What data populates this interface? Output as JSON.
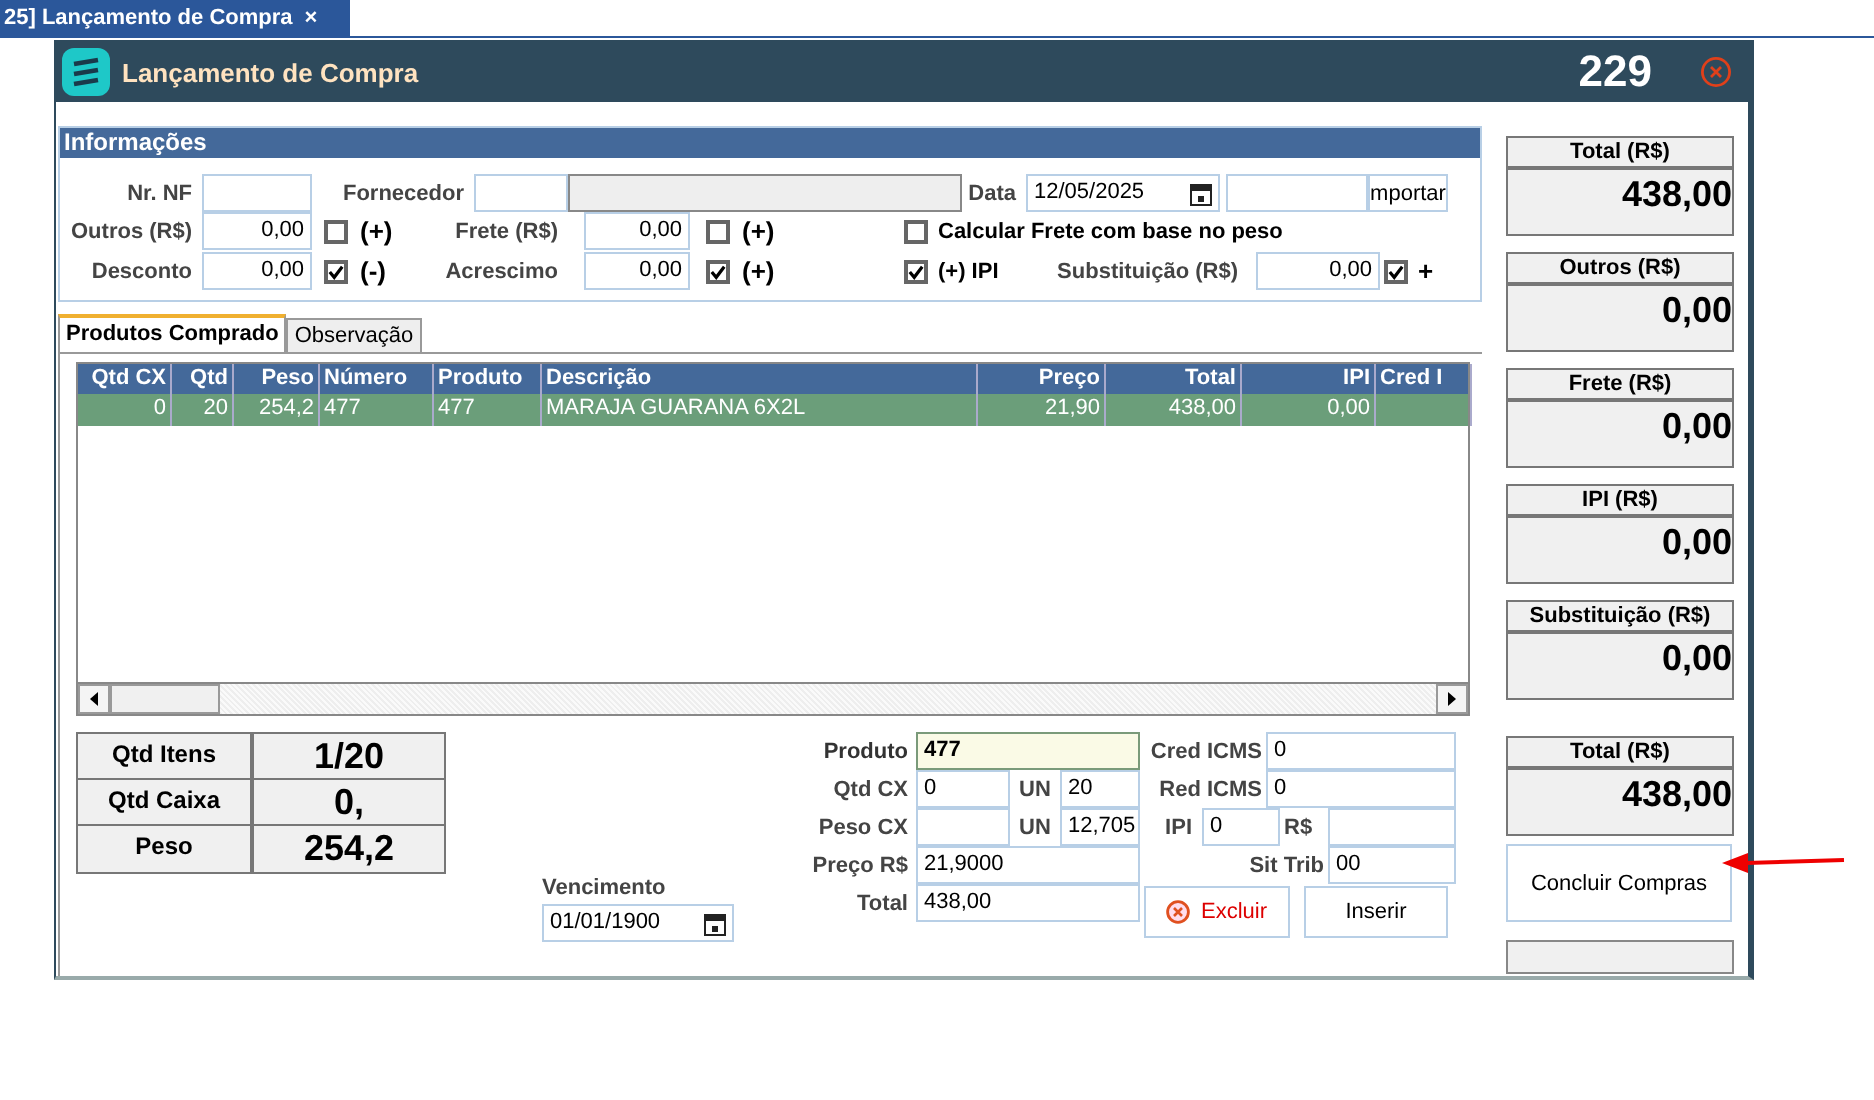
{
  "app_tab": {
    "label": "25] Lançamento de Compra",
    "close": "×"
  },
  "window": {
    "title": "Lançamento de Compra",
    "number": "229"
  },
  "info": {
    "title": "Informações",
    "nr_nf": {
      "label": "Nr. NF"
    },
    "fornecedor": {
      "label": "Fornecedor"
    },
    "data": {
      "label": "Data",
      "value": "12/05/2025"
    },
    "import_button": "mportar",
    "outros": {
      "label": "Outros (R$)",
      "value": "0,00",
      "checked": false,
      "sign": "(+)"
    },
    "frete": {
      "label": "Frete (R$)",
      "value": "0,00",
      "checked": false,
      "sign": "(+)"
    },
    "calc_frete": {
      "label": "Calcular Frete com base no peso",
      "checked": false
    },
    "desconto": {
      "label": "Desconto",
      "value": "0,00",
      "checked": true,
      "sign": "(-)"
    },
    "acrescimo": {
      "label": "Acrescimo",
      "value": "0,00",
      "checked": true,
      "sign": "(+)"
    },
    "ipi": {
      "label": "(+) IPI",
      "checked": true
    },
    "substituicao": {
      "label": "Substituição (R$)",
      "value": "0,00",
      "checked": true,
      "sign": "+"
    }
  },
  "tabs": [
    {
      "label": "Produtos Comprado",
      "selected": true
    },
    {
      "label": "Observação",
      "selected": false
    }
  ],
  "table": {
    "columns": [
      "Qtd CX",
      "Qtd",
      "Peso",
      "Número",
      "Produto",
      "Descrição",
      "Preço",
      "Total",
      "IPI",
      "Cred I"
    ],
    "rows": [
      {
        "selected": true,
        "cells": [
          "0",
          "20",
          "254,2",
          "477",
          "477",
          "MARAJA GUARANA 6X2L",
          "21,90",
          "438,00",
          "0,00",
          ""
        ]
      }
    ]
  },
  "summary": [
    {
      "label": "Qtd Itens",
      "value": "1/20"
    },
    {
      "label": "Qtd Caixa",
      "value": "0,"
    },
    {
      "label": "Peso",
      "value": "254,2"
    }
  ],
  "vencimento": {
    "label": "Vencimento",
    "value": "01/01/1900"
  },
  "item": {
    "produto": {
      "label": "Produto",
      "value": "477"
    },
    "qtd_cx": {
      "label": "Qtd CX",
      "value": "0",
      "un_label": "UN",
      "un_value": "20"
    },
    "peso_cx": {
      "label": "Peso CX",
      "un_label": "UN",
      "un_value": "12,705"
    },
    "preco": {
      "label": "Preço R$",
      "value": "21,9000"
    },
    "total": {
      "label": "Total",
      "value": "438,00"
    },
    "cred_icms": {
      "label": "Cred ICMS",
      "value": "0"
    },
    "red_icms": {
      "label": "Red ICMS",
      "value": "0"
    },
    "ipi": {
      "label": "IPI",
      "value": "0",
      "rs_label": "R$"
    },
    "sit_trib": {
      "label": "Sit Trib",
      "value": "00"
    },
    "excluir": "Excluir",
    "inserir": "Inserir"
  },
  "totals": [
    {
      "label": "Total (R$)",
      "value": "438,00"
    },
    {
      "label": "Outros (R$)",
      "value": "0,00"
    },
    {
      "label": "Frete (R$)",
      "value": "0,00"
    },
    {
      "label": "IPI (R$)",
      "value": "0,00"
    },
    {
      "label": "Substituição (R$)",
      "value": "0,00"
    },
    {
      "label": "Total (R$)",
      "value": "438,00"
    }
  ],
  "conclude_button": "Concluir Compras"
}
